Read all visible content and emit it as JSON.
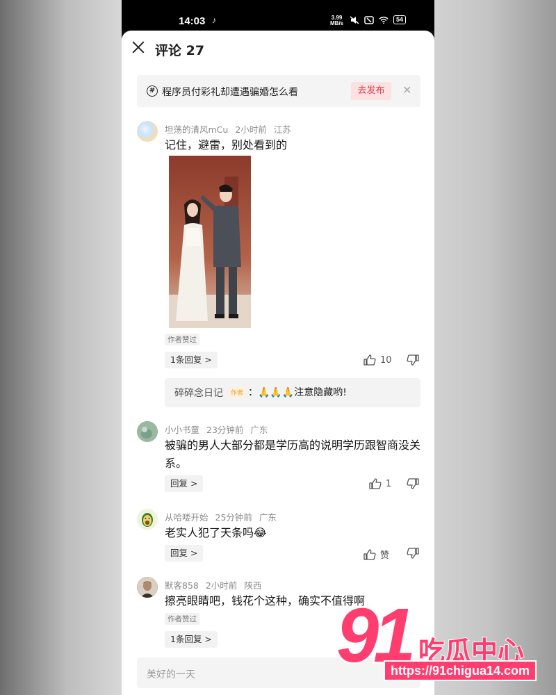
{
  "status_bar": {
    "time": "14:03",
    "app_glyph": "♪",
    "net_speed_value": "3.99",
    "net_speed_unit": "MB/s",
    "battery": "54"
  },
  "header": {
    "title": "评论 27"
  },
  "topic": {
    "text": "程序员付彩礼却遭遇骗婚怎么看",
    "publish_label": "去发布"
  },
  "comments": [
    {
      "username": "坦荡的清风mCu",
      "time": "2小时前",
      "location": "江苏",
      "text": "记住，避雷，别处看到的",
      "author_liked": "作者赞过",
      "reply_label": "1条回复 >",
      "likes": "10",
      "sub_reply": {
        "name": "碎碎念日记",
        "tag": "作者",
        "text": "：🙏🙏🙏注意隐藏哟!"
      }
    },
    {
      "username": "小小书童",
      "time": "23分钟前",
      "location": "广东",
      "text": "被骗的男人大部分都是学历高的说明学历跟智商没关系。",
      "reply_label": "回复 >",
      "likes": "1"
    },
    {
      "username": "从哈喽开始",
      "time": "25分钟前",
      "location": "广东",
      "text": "老实人犯了天条吗😂",
      "reply_label": "回复 >",
      "likes": "赞"
    },
    {
      "username": "默客858",
      "time": "2小时前",
      "location": "陕西",
      "text": "擦亮眼睛吧，钱花个这种，确实不值得啊",
      "author_liked": "作者赞过",
      "reply_label": "1条回复 >"
    }
  ],
  "input": {
    "placeholder": "美好的一天"
  },
  "watermark": {
    "number": "91",
    "name": "吃瓜中心",
    "url": "https://91chigua14.com"
  },
  "colors": {
    "accent": "#e23a4a",
    "watermark_pink": "#ff3d6e"
  }
}
